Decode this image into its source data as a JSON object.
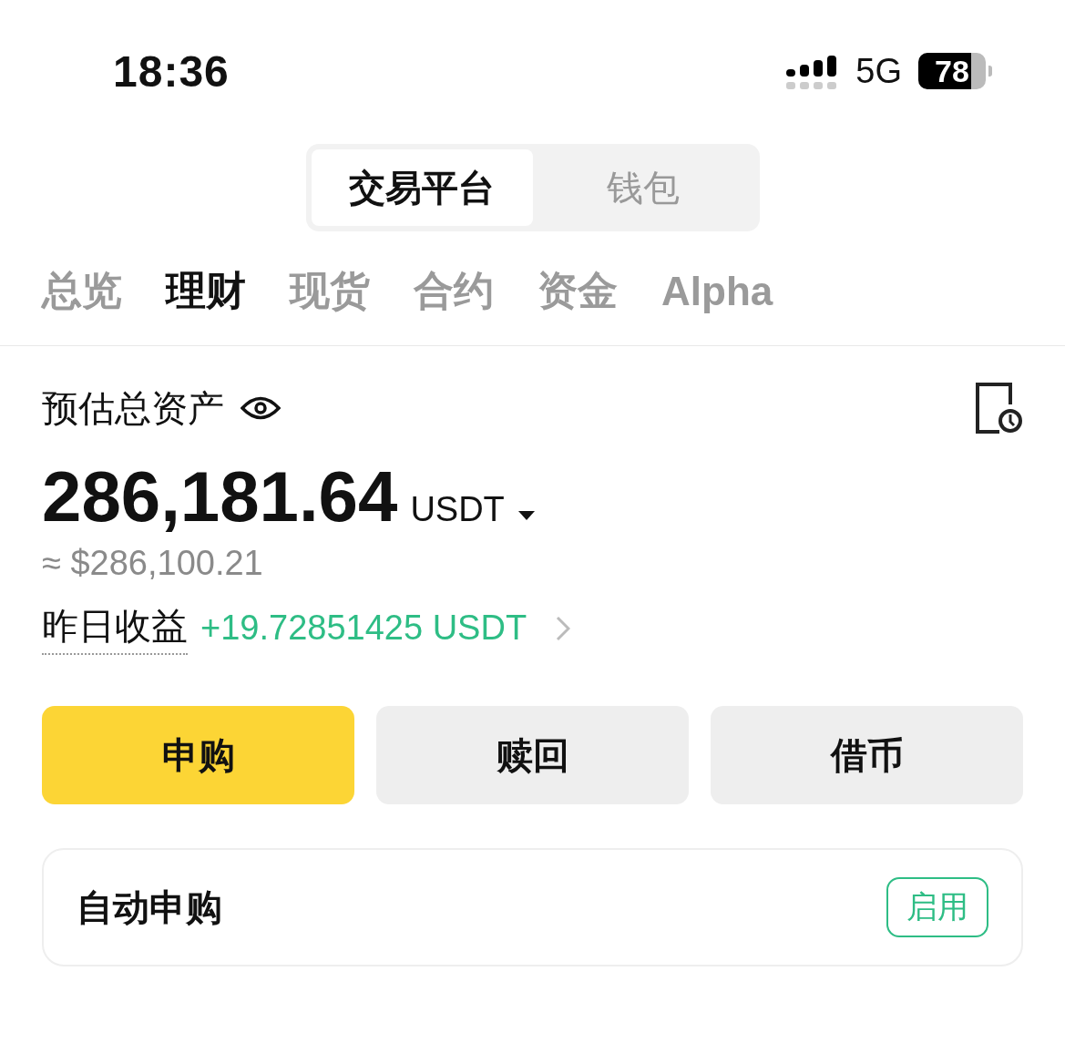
{
  "status_bar": {
    "time": "18:36",
    "network": "5G",
    "battery": "78"
  },
  "segments": [
    {
      "label": "交易平台",
      "selected": true
    },
    {
      "label": "钱包",
      "selected": false
    }
  ],
  "tabs": [
    {
      "label": "总览",
      "selected": false
    },
    {
      "label": "理财",
      "selected": true
    },
    {
      "label": "现货",
      "selected": false
    },
    {
      "label": "合约",
      "selected": false
    },
    {
      "label": "资金",
      "selected": false
    },
    {
      "label": "Alpha",
      "selected": false
    }
  ],
  "assets": {
    "title": "预估总资产",
    "amount": "286,181.64",
    "currency": "USDT",
    "fiat": "≈ $286,100.21",
    "yesterday_label": "昨日收益",
    "yesterday_value": "+19.72851425 USDT"
  },
  "actions": [
    {
      "label": "申购",
      "kind": "primary"
    },
    {
      "label": "赎回",
      "kind": "secondary"
    },
    {
      "label": "借币",
      "kind": "secondary"
    }
  ],
  "auto_subscribe": {
    "label": "自动申购",
    "badge": "启用"
  }
}
